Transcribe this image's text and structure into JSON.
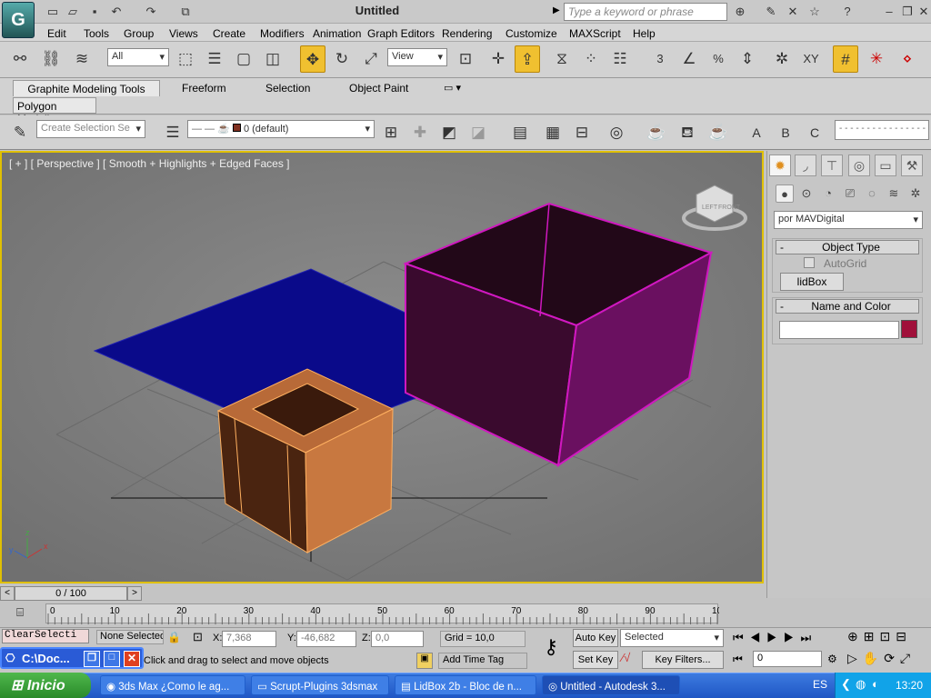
{
  "app": {
    "logo": "G",
    "title": "Untitled",
    "search_placeholder": "Type a keyword or phrase"
  },
  "menu": [
    "Edit",
    "Tools",
    "Group",
    "Views",
    "Create",
    "Modifiers",
    "Animation",
    "Graph Editors",
    "Rendering",
    "Customize",
    "MAXScript",
    "Help"
  ],
  "main_toolbar": {
    "filter_value": "All",
    "ref_coord_value": "View",
    "snap_values": [
      "3",
      "%",
      "XY"
    ]
  },
  "ribbon": {
    "tabs": [
      "Graphite Modeling Tools",
      "Freeform",
      "Selection",
      "Object Paint"
    ],
    "panel": "Polygon Modeling"
  },
  "toolbar2": {
    "selection_set_placeholder": "Create Selection Se",
    "layer_value": "0 (default)",
    "named_letters": [
      "A",
      "B",
      "C"
    ]
  },
  "viewport": {
    "label": "[ + ] [ Perspective ] [ Smooth + Highlights + Edged Faces ]",
    "axis_labels": [
      "z",
      "y",
      "x"
    ],
    "viewcube_labels": [
      "LEFT",
      "FRONT"
    ]
  },
  "command_panel": {
    "category_value": "por MAVDigital",
    "object_type_header": "Object Type",
    "autogrid_label": "AutoGrid",
    "button_lidbox": "lidBox",
    "name_color_header": "Name and Color",
    "name_value": "",
    "swatch_color": "#a0103a",
    "rollout_toggle": "-"
  },
  "timeline": {
    "frame_display": "0 / 100",
    "ticks": [
      "0",
      "10",
      "20",
      "30",
      "40",
      "50",
      "60",
      "70",
      "80",
      "90",
      "100"
    ]
  },
  "status": {
    "maxscript_listener": "ClearSelecti",
    "selection_status": "None Selected",
    "x_label": "X:",
    "x_value": "7,368",
    "y_label": "Y:",
    "y_value": "-46,682",
    "z_label": "Z:",
    "z_value": "0,0",
    "grid": "Grid = 10,0",
    "prompt": "Click and drag to select and move objects",
    "add_time_tag": "Add Time Tag",
    "auto_key": "Auto Key",
    "set_key": "Set Key",
    "key_mode_value": "Selected",
    "key_filters": "Key Filters...",
    "frame_value": "0"
  },
  "floating_window": {
    "title": "C:\\Doc..."
  },
  "taskbar": {
    "start": "Inicio",
    "tasks": [
      "3ds Max ¿Como le ag...",
      "Scrupt-Plugins 3dsmax",
      "LidBox 2b - Bloc de n...",
      "Untitled - Autodesk 3..."
    ],
    "lang": "ES",
    "clock": "13:20"
  },
  "colors": {
    "viewport_bg": "#838383",
    "plane": "#0a0a8a",
    "box_magenta": "#c010b0",
    "box_orange": "#e0884a",
    "selection_border": "#e0c000"
  }
}
